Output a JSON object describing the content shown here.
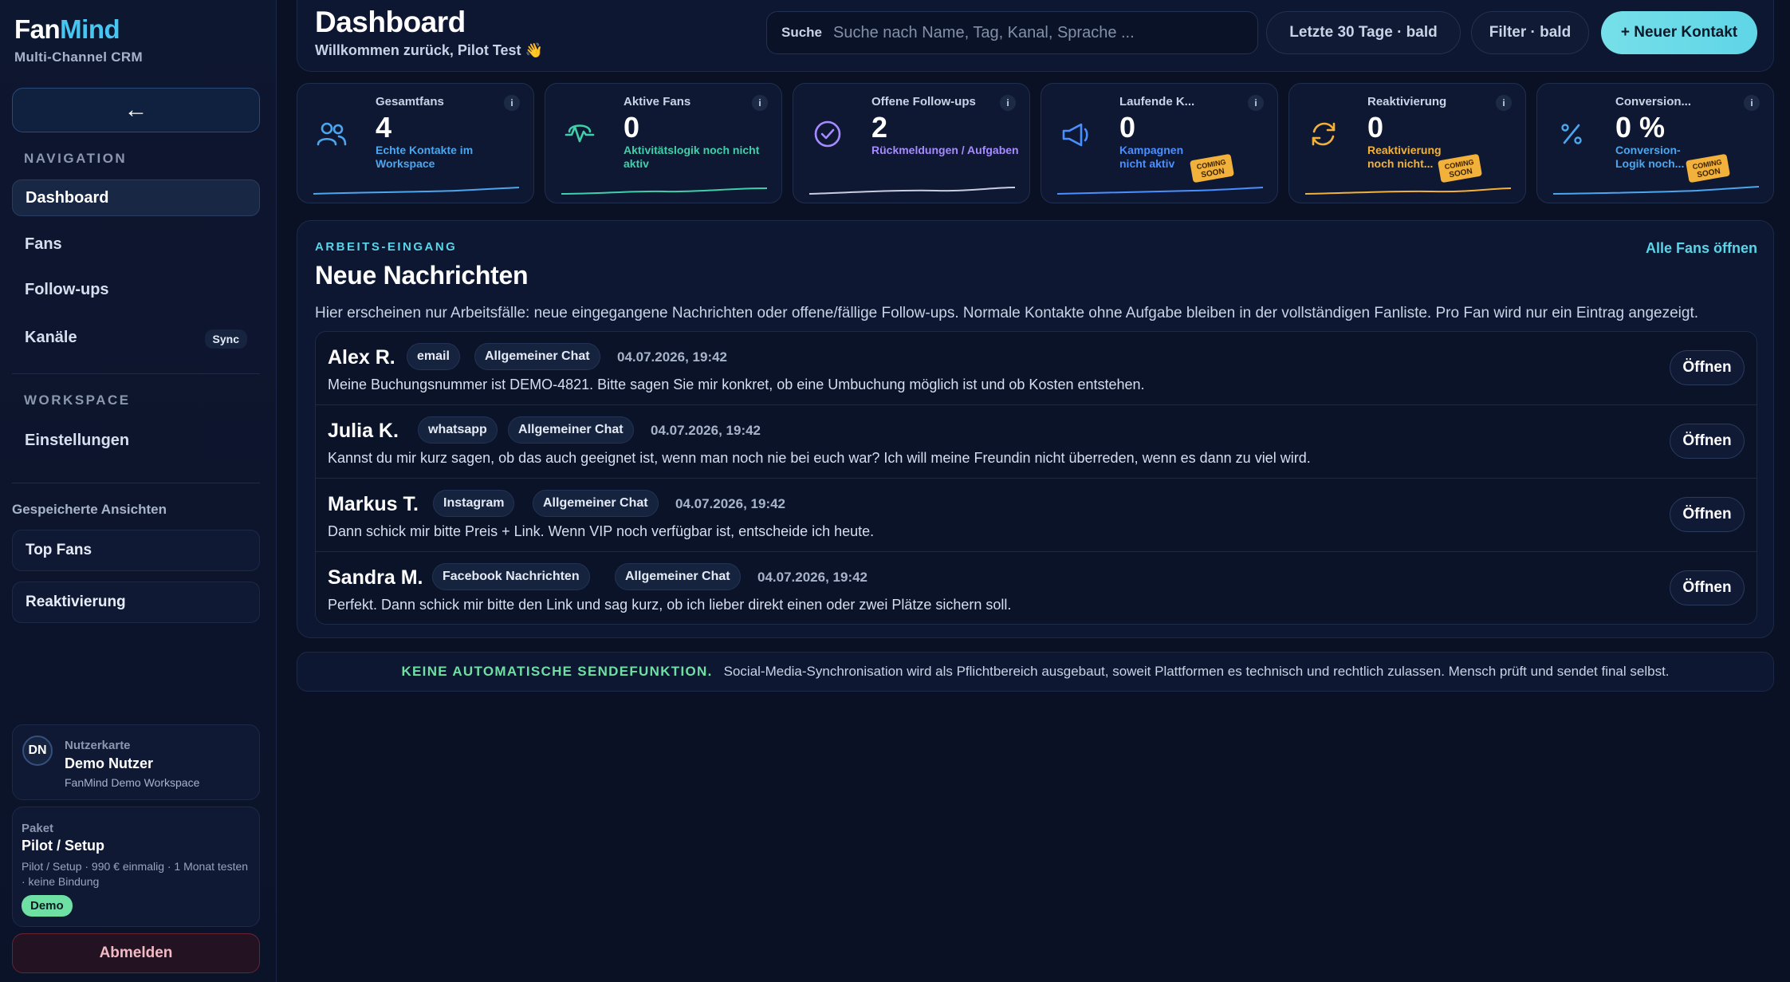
{
  "brand": {
    "name_part1": "Fan",
    "name_part2": "Mind",
    "subtitle": "Multi-Channel CRM"
  },
  "sidebar": {
    "collapse_icon": "←",
    "nav_title": "NAVIGATION",
    "nav_items": [
      {
        "label": "Dashboard",
        "active": true
      },
      {
        "label": "Fans"
      },
      {
        "label": "Follow-ups"
      },
      {
        "label": "Kanäle",
        "badge": "Sync"
      }
    ],
    "workspace_title": "WORKSPACE",
    "workspace_items": [
      {
        "label": "Einstellungen"
      }
    ],
    "saved_title": "Gespeicherte Ansichten",
    "saved_items": [
      {
        "label": "Top Fans"
      },
      {
        "label": "Reaktivierung"
      }
    ],
    "user_card": {
      "initials": "DN",
      "label": "Nutzerkarte",
      "name": "Demo Nutzer",
      "workspace": "FanMind Demo Workspace"
    },
    "package": {
      "label": "Paket",
      "name": "Pilot / Setup",
      "description": "Pilot / Setup · 990 € einmalig · 1 Monat testen · keine Bindung",
      "badge": "Demo"
    },
    "logout_label": "Abmelden"
  },
  "header": {
    "title": "Dashboard",
    "welcome": "Willkommen zurück, Pilot Test 👋",
    "search_label": "Suche",
    "search_placeholder": "Suche nach Name, Tag, Kanal, Sprache ...",
    "range_button": "Letzte 30 Tage · bald",
    "filter_button": "Filter · bald",
    "new_contact_button": "+ Neuer Kontakt"
  },
  "stats": [
    {
      "label": "Gesamtfans",
      "value": "4",
      "desc": "Echte Kontakte im Workspace",
      "icon": "users-icon",
      "color": "#4ca6ee",
      "coming_soon": false
    },
    {
      "label": "Aktive Fans",
      "value": "0",
      "desc": "Aktivitätslogik noch nicht aktiv",
      "icon": "activity-icon",
      "color": "#3fcfa9",
      "coming_soon": false
    },
    {
      "label": "Offene Follow-ups",
      "value": "2",
      "desc": "Rückmeldungen / Aufgaben",
      "icon": "check-circle-icon",
      "color": "#a58bff",
      "coming_soon": false
    },
    {
      "label": "Laufende K...",
      "value": "0",
      "desc": "Kampagnen nicht aktiv",
      "icon": "megaphone-icon",
      "color": "#4a8fff",
      "coming_soon": true
    },
    {
      "label": "Reaktivierung",
      "value": "0",
      "desc": "Reaktivierung noch nicht...",
      "icon": "refresh-icon",
      "color": "#f2b13a",
      "coming_soon": true
    },
    {
      "label": "Conversion...",
      "value": "0 %",
      "desc": "Conversion-Logik noch...",
      "icon": "percent-icon",
      "color": "#4ca6ee",
      "coming_soon": true
    }
  ],
  "coming_soon_text": {
    "line1": "COMING",
    "line2": "SOON"
  },
  "info_glyph": "i",
  "inbox": {
    "kicker": "ARBEITS-EINGANG",
    "title": "Neue Nachrichten",
    "link": "Alle Fans öffnen",
    "description": "Hier erscheinen nur Arbeitsfälle: neue eingegangene Nachrichten oder offene/fällige Follow-ups. Normale Kontakte ohne Aufgabe bleiben in der vollständigen Fanliste. Pro Fan wird nur ein Eintrag angezeigt.",
    "open_label": "Öffnen",
    "messages": [
      {
        "name": "Alex R.",
        "channel": "email",
        "chat": "Allgemeiner Chat",
        "date": "04.07.2026, 19:42",
        "text": "Meine Buchungsnummer ist DEMO-4821. Bitte sagen Sie mir konkret, ob eine Umbuchung möglich ist und ob Kosten entstehen."
      },
      {
        "name": "Julia K.",
        "channel": "whatsapp",
        "chat": "Allgemeiner Chat",
        "date": "04.07.2026, 19:42",
        "text": "Kannst du mir kurz sagen, ob das auch geeignet ist, wenn man noch nie bei euch war? Ich will meine Freundin nicht überreden, wenn es dann zu viel wird."
      },
      {
        "name": "Markus T.",
        "channel": "Instagram",
        "chat": "Allgemeiner Chat",
        "date": "04.07.2026, 19:42",
        "text": "Dann schick mir bitte Preis + Link. Wenn VIP noch verfügbar ist, entscheide ich heute."
      },
      {
        "name": "Sandra M.",
        "channel": "Facebook Nachrichten",
        "chat": "Allgemeiner Chat",
        "date": "04.07.2026, 19:42",
        "text": "Perfekt. Dann schick mir bitte den Link und sag kurz, ob ich lieber direkt einen oder zwei Plätze sichern soll."
      }
    ]
  },
  "notice": {
    "strong": "KEINE AUTOMATISCHE SENDEFUNKTION.",
    "text": "Social-Media-Synchronisation wird als Pflichtbereich ausgebaut, soweit Plattformen es technisch und rechtlich zulassen. Mensch prüft und sendet final selbst."
  }
}
